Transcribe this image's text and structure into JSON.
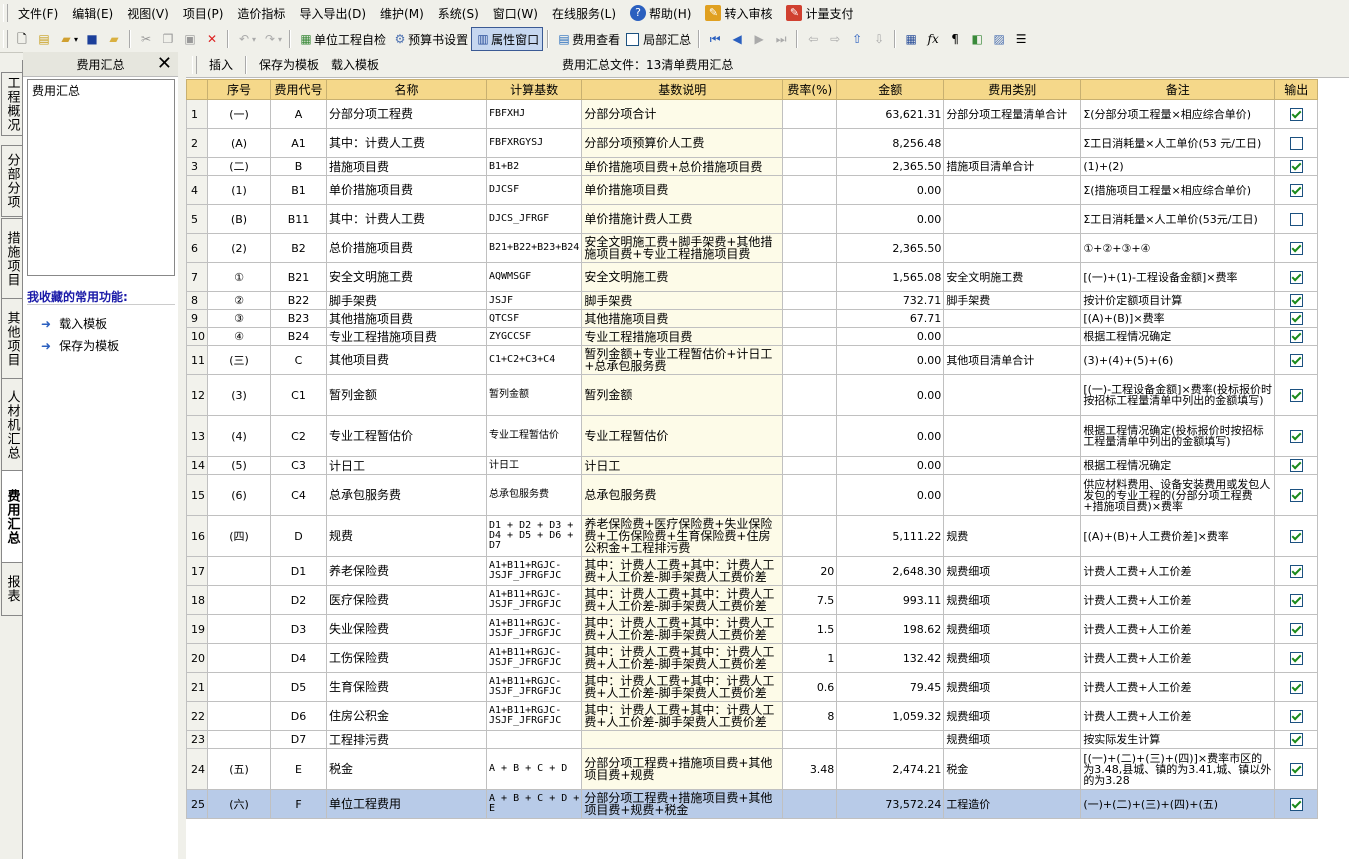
{
  "menubar": [
    {
      "label": "文件(F)",
      "icon": "app-icon"
    },
    {
      "label": "编辑(E)"
    },
    {
      "label": "视图(V)"
    },
    {
      "label": "项目(P)"
    },
    {
      "label": "造价指标"
    },
    {
      "label": "导入导出(D)"
    },
    {
      "label": "维护(M)"
    },
    {
      "label": "系统(S)"
    },
    {
      "label": "窗口(W)"
    },
    {
      "label": "在线服务(L)"
    },
    {
      "label": "帮助(H)",
      "icon": "help-icon"
    },
    {
      "label": "转入审核",
      "icon": "audit-icon"
    },
    {
      "label": "计量支付",
      "icon": "payment-icon"
    }
  ],
  "toolbar": {
    "self_check": "单位工程自检",
    "budget_settings": "预算书设置",
    "property_window": "属性窗口",
    "fee_view": "费用查看",
    "partial_summary": "局部汇总"
  },
  "side_tabs": [
    "工程概况",
    "分部分项",
    "措施项目",
    "其他项目",
    "人材机汇总",
    "费用汇总",
    "报表"
  ],
  "left_panel": {
    "title": "费用汇总",
    "list_item": "费用汇总",
    "favorites_title": "我收藏的常用功能:",
    "favorites": [
      "载入模板",
      "保存为模板"
    ]
  },
  "subbar": {
    "insert": "插入",
    "save_template": "保存为模板",
    "load_template": "载入模板",
    "file_label": "费用汇总文件：13清单费用汇总"
  },
  "table": {
    "headers": [
      "序号",
      "费用代号",
      "名称",
      "计算基数",
      "基数说明",
      "费率(%)",
      "金额",
      "费用类别",
      "备注",
      "输出"
    ],
    "rows": [
      {
        "n": "1",
        "seq": "(一)",
        "code": "A",
        "name": "分部分项工程费",
        "base": "FBFXHJ",
        "desc": "分部分项合计",
        "rate": "",
        "amount": "63,621.31",
        "cat": "分部分项工程量清单合计",
        "note": "Σ(分部分项工程量×相应综合单价)",
        "out": true
      },
      {
        "n": "2",
        "seq": "(A)",
        "code": "A1",
        "name": "其中：计费人工费",
        "base": "FBFXRGYSJ",
        "desc": "分部分项预算价人工费",
        "rate": "",
        "amount": "8,256.48",
        "cat": "",
        "note": "Σ工日消耗量×人工单价(53 元/工日)",
        "out": false
      },
      {
        "n": "3",
        "seq": "(二)",
        "code": "B",
        "name": "措施项目费",
        "base": "B1+B2",
        "desc": "单价措施项目费+总价措施项目费",
        "rate": "",
        "amount": "2,365.50",
        "cat": "措施项目清单合计",
        "note": "(1)+(2)",
        "out": true
      },
      {
        "n": "4",
        "seq": "(1)",
        "code": "B1",
        "name": "单价措施项目费",
        "base": "DJCSF",
        "desc": "单价措施项目费",
        "rate": "",
        "amount": "0.00",
        "cat": "",
        "note": "Σ(措施项目工程量×相应综合单价)",
        "out": true
      },
      {
        "n": "5",
        "seq": "(B)",
        "code": "B11",
        "name": "其中：计费人工费",
        "base": "DJCS_JFRGF",
        "desc": "单价措施计费人工费",
        "rate": "",
        "amount": "0.00",
        "cat": "",
        "note": "Σ工日消耗量×人工单价(53元/工日)",
        "out": false
      },
      {
        "n": "6",
        "seq": "(2)",
        "code": "B2",
        "name": "总价措施项目费",
        "base": "B21+B22+B23+B24",
        "desc": "安全文明施工费+脚手架费+其他措施项目费+专业工程措施项目费",
        "rate": "",
        "amount": "2,365.50",
        "cat": "",
        "note": "①+②+③+④",
        "out": true
      },
      {
        "n": "7",
        "seq": "①",
        "code": "B21",
        "name": "安全文明施工费",
        "base": "AQWMSGF",
        "desc": "安全文明施工费",
        "rate": "",
        "amount": "1,565.08",
        "cat": "安全文明施工费",
        "note": "[(一)+(1)-工程设备金额]×费率",
        "out": true
      },
      {
        "n": "8",
        "seq": "②",
        "code": "B22",
        "name": "脚手架费",
        "base": "JSJF",
        "desc": "脚手架费",
        "rate": "",
        "amount": "732.71",
        "cat": "脚手架费",
        "note": "按计价定额项目计算",
        "out": true
      },
      {
        "n": "9",
        "seq": "③",
        "code": "B23",
        "name": "其他措施项目费",
        "base": "QTCSF",
        "desc": "其他措施项目费",
        "rate": "",
        "amount": "67.71",
        "cat": "",
        "note": "[(A)+(B)]×费率",
        "out": true
      },
      {
        "n": "10",
        "seq": "④",
        "code": "B24",
        "name": "专业工程措施项目费",
        "base": "ZYGCCSF",
        "desc": "专业工程措施项目费",
        "rate": "",
        "amount": "0.00",
        "cat": "",
        "note": "根据工程情况确定",
        "out": true
      },
      {
        "n": "11",
        "seq": "(三)",
        "code": "C",
        "name": "其他项目费",
        "base": "C1+C2+C3+C4",
        "desc": "暂列金额+专业工程暂估价+计日工+总承包服务费",
        "rate": "",
        "amount": "0.00",
        "cat": "其他项目清单合计",
        "note": "(3)+(4)+(5)+(6)",
        "out": true
      },
      {
        "n": "12",
        "seq": "(3)",
        "code": "C1",
        "name": "暂列金额",
        "base": "暂列金额",
        "desc": "暂列金额",
        "rate": "",
        "amount": "0.00",
        "cat": "",
        "note": "[(一)-工程设备金额]×费率(投标报价时按招标工程量清单中列出的金额填写)",
        "out": true
      },
      {
        "n": "13",
        "seq": "(4)",
        "code": "C2",
        "name": "专业工程暂估价",
        "base": "专业工程暂估价",
        "desc": "专业工程暂估价",
        "rate": "",
        "amount": "0.00",
        "cat": "",
        "note": "根据工程情况确定(投标报价时按招标工程量清单中列出的金额填写)",
        "out": true
      },
      {
        "n": "14",
        "seq": "(5)",
        "code": "C3",
        "name": "计日工",
        "base": "计日工",
        "desc": "计日工",
        "rate": "",
        "amount": "0.00",
        "cat": "",
        "note": "根据工程情况确定",
        "out": true
      },
      {
        "n": "15",
        "seq": "(6)",
        "code": "C4",
        "name": "总承包服务费",
        "base": "总承包服务费",
        "desc": "总承包服务费",
        "rate": "",
        "amount": "0.00",
        "cat": "",
        "note": "供应材料费用、设备安装费用或发包人发包的专业工程的(分部分项工程费+措施项目费)×费率",
        "out": true
      },
      {
        "n": "16",
        "seq": "(四)",
        "code": "D",
        "name": "规费",
        "base": "D1 + D2 + D3 + D4 + D5 + D6 + D7",
        "desc": "养老保险费+医疗保险费+失业保险费+工伤保险费+生育保险费+住房公积金+工程排污费",
        "rate": "",
        "amount": "5,111.22",
        "cat": "规费",
        "note": "[(A)+(B)+人工费价差]×费率",
        "out": true
      },
      {
        "n": "17",
        "seq": "",
        "code": "D1",
        "name": "养老保险费",
        "base": "A1+B11+RGJC-JSJF_JFRGFJC",
        "desc": "其中：计费人工费+其中：计费人工费+人工价差-脚手架费人工费价差",
        "rate": "20",
        "amount": "2,648.30",
        "cat": "规费细项",
        "note": "计费人工费+人工价差",
        "out": true
      },
      {
        "n": "18",
        "seq": "",
        "code": "D2",
        "name": "医疗保险费",
        "base": "A1+B11+RGJC-JSJF_JFRGFJC",
        "desc": "其中：计费人工费+其中：计费人工费+人工价差-脚手架费人工费价差",
        "rate": "7.5",
        "amount": "993.11",
        "cat": "规费细项",
        "note": "计费人工费+人工价差",
        "out": true
      },
      {
        "n": "19",
        "seq": "",
        "code": "D3",
        "name": "失业保险费",
        "base": "A1+B11+RGJC-JSJF_JFRGFJC",
        "desc": "其中：计费人工费+其中：计费人工费+人工价差-脚手架费人工费价差",
        "rate": "1.5",
        "amount": "198.62",
        "cat": "规费细项",
        "note": "计费人工费+人工价差",
        "out": true
      },
      {
        "n": "20",
        "seq": "",
        "code": "D4",
        "name": "工伤保险费",
        "base": "A1+B11+RGJC-JSJF_JFRGFJC",
        "desc": "其中：计费人工费+其中：计费人工费+人工价差-脚手架费人工费价差",
        "rate": "1",
        "amount": "132.42",
        "cat": "规费细项",
        "note": "计费人工费+人工价差",
        "out": true
      },
      {
        "n": "21",
        "seq": "",
        "code": "D5",
        "name": "生育保险费",
        "base": "A1+B11+RGJC-JSJF_JFRGFJC",
        "desc": "其中：计费人工费+其中：计费人工费+人工价差-脚手架费人工费价差",
        "rate": "0.6",
        "amount": "79.45",
        "cat": "规费细项",
        "note": "计费人工费+人工价差",
        "out": true
      },
      {
        "n": "22",
        "seq": "",
        "code": "D6",
        "name": "住房公积金",
        "base": "A1+B11+RGJC-JSJF_JFRGFJC",
        "desc": "其中：计费人工费+其中：计费人工费+人工价差-脚手架费人工费价差",
        "rate": "8",
        "amount": "1,059.32",
        "cat": "规费细项",
        "note": "计费人工费+人工价差",
        "out": true
      },
      {
        "n": "23",
        "seq": "",
        "code": "D7",
        "name": "工程排污费",
        "base": "",
        "desc": "",
        "rate": "",
        "amount": "",
        "cat": "规费细项",
        "note": "按实际发生计算",
        "out": true
      },
      {
        "n": "24",
        "seq": "(五)",
        "code": "E",
        "name": "税金",
        "base": "A + B + C + D",
        "desc": "分部分项工程费+措施项目费+其他项目费+规费",
        "rate": "3.48",
        "amount": "2,474.21",
        "cat": "税金",
        "note": "[(一)+(二)+(三)+(四)]×费率市区的为3.48,县城、镇的为3.41,城、镇以外的为3.28",
        "out": true
      },
      {
        "n": "25",
        "seq": "(六)",
        "code": "F",
        "name": "单位工程费用",
        "base": "A + B + C + D + E",
        "desc": "分部分项工程费+措施项目费+其他项目费+规费+税金",
        "rate": "",
        "amount": "73,572.24",
        "cat": "工程造价",
        "note": "(一)+(二)+(三)+(四)+(五)",
        "out": true
      }
    ]
  }
}
